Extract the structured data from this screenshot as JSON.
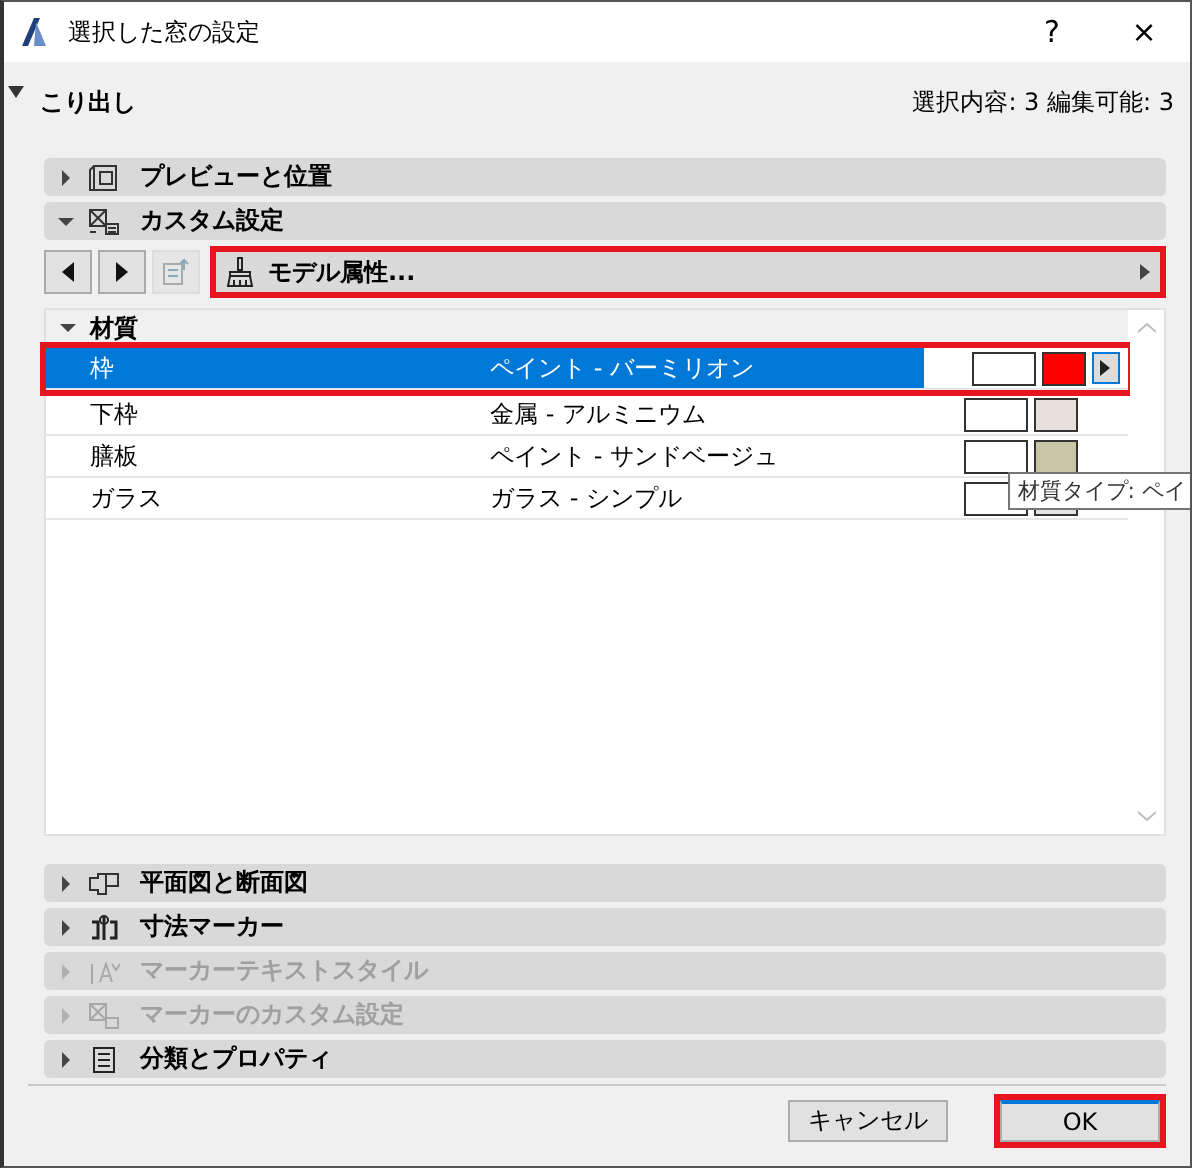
{
  "window": {
    "title": "選択した窓の設定",
    "help": "?",
    "close": "×"
  },
  "header": {
    "label": "こり出し",
    "selection": "選択内容: 3 編集可能: 3"
  },
  "sections": [
    {
      "label": "プレビューと位置",
      "expanded": false,
      "disabled": false
    },
    {
      "label": "カスタム設定",
      "expanded": true,
      "disabled": false
    },
    {
      "label": "平面図と断面図",
      "expanded": false,
      "disabled": false
    },
    {
      "label": "寸法マーカー",
      "expanded": false,
      "disabled": false
    },
    {
      "label": "マーカーテキストスタイル",
      "expanded": false,
      "disabled": true
    },
    {
      "label": "マーカーのカスタム設定",
      "expanded": false,
      "disabled": true
    },
    {
      "label": "分類とプロパティ",
      "expanded": false,
      "disabled": false
    }
  ],
  "toolbar": {
    "attribute": "モデル属性...",
    "highlighted": true
  },
  "materials": {
    "group": "材質",
    "expanded": true,
    "rows": [
      {
        "name": "枠",
        "material": "ペイント - バーミリオン",
        "selected": true,
        "highlighted": true,
        "color": "#ff0000"
      },
      {
        "name": "下枠",
        "material": "金属 - アルミニウム",
        "selected": false,
        "highlighted": false,
        "color": "#e8e0dc"
      },
      {
        "name": "膳板",
        "material": "ペイント - サンドベージュ",
        "selected": false,
        "highlighted": false,
        "color": "#c8c4a4"
      },
      {
        "name": "ガラス",
        "material": "ガラス - シンプル",
        "selected": false,
        "highlighted": false,
        "color": "#e4e4e4"
      }
    ]
  },
  "tooltip": "材質タイプ: ペイ",
  "buttons": [
    {
      "label": "キャンセル",
      "kind": "cancel",
      "highlighted": false
    },
    {
      "label": "OK",
      "kind": "default",
      "highlighted": true
    }
  ]
}
